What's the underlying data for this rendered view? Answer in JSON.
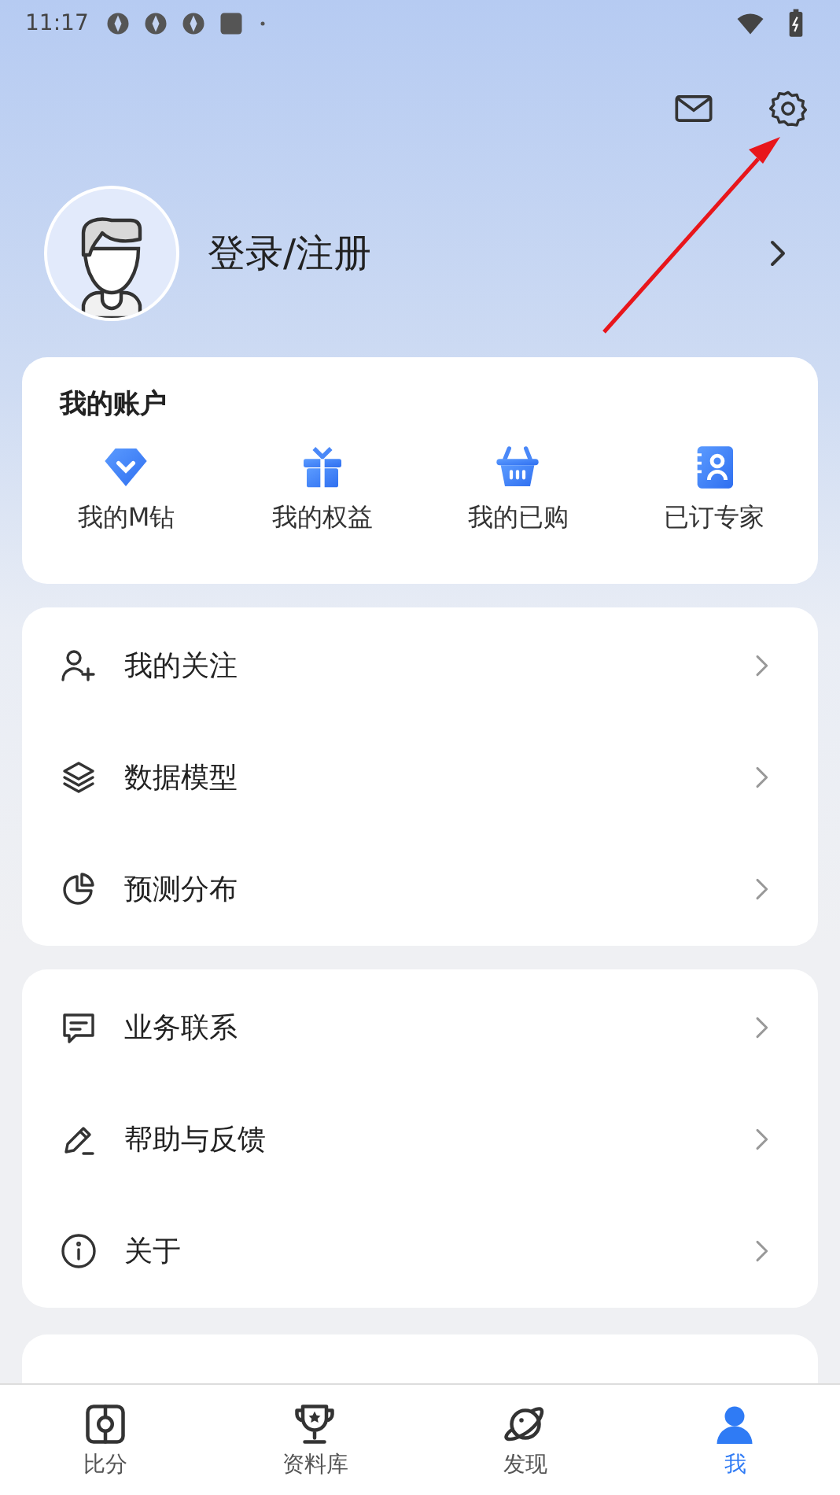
{
  "status_bar": {
    "time": "11:17"
  },
  "profile": {
    "login_label": "登录/注册"
  },
  "account": {
    "title": "我的账户",
    "items": [
      {
        "kind": "diamond",
        "label": "我的M钻"
      },
      {
        "kind": "gift",
        "label": "我的权益"
      },
      {
        "kind": "basket",
        "label": "我的已购"
      },
      {
        "kind": "contact",
        "label": "已订专家"
      }
    ]
  },
  "menu_groups": [
    [
      {
        "kind": "follow",
        "label": "我的关注"
      },
      {
        "kind": "layers",
        "label": "数据模型"
      },
      {
        "kind": "pie",
        "label": "预测分布"
      }
    ],
    [
      {
        "kind": "message",
        "label": "业务联系"
      },
      {
        "kind": "pen",
        "label": "帮助与反馈"
      },
      {
        "kind": "info",
        "label": "关于"
      }
    ]
  ],
  "tabs": [
    {
      "kind": "score",
      "label": "比分",
      "selected": false
    },
    {
      "kind": "trophy",
      "label": "资料库",
      "selected": false
    },
    {
      "kind": "planet",
      "label": "发现",
      "selected": false
    },
    {
      "kind": "me",
      "label": "我",
      "selected": true
    }
  ]
}
